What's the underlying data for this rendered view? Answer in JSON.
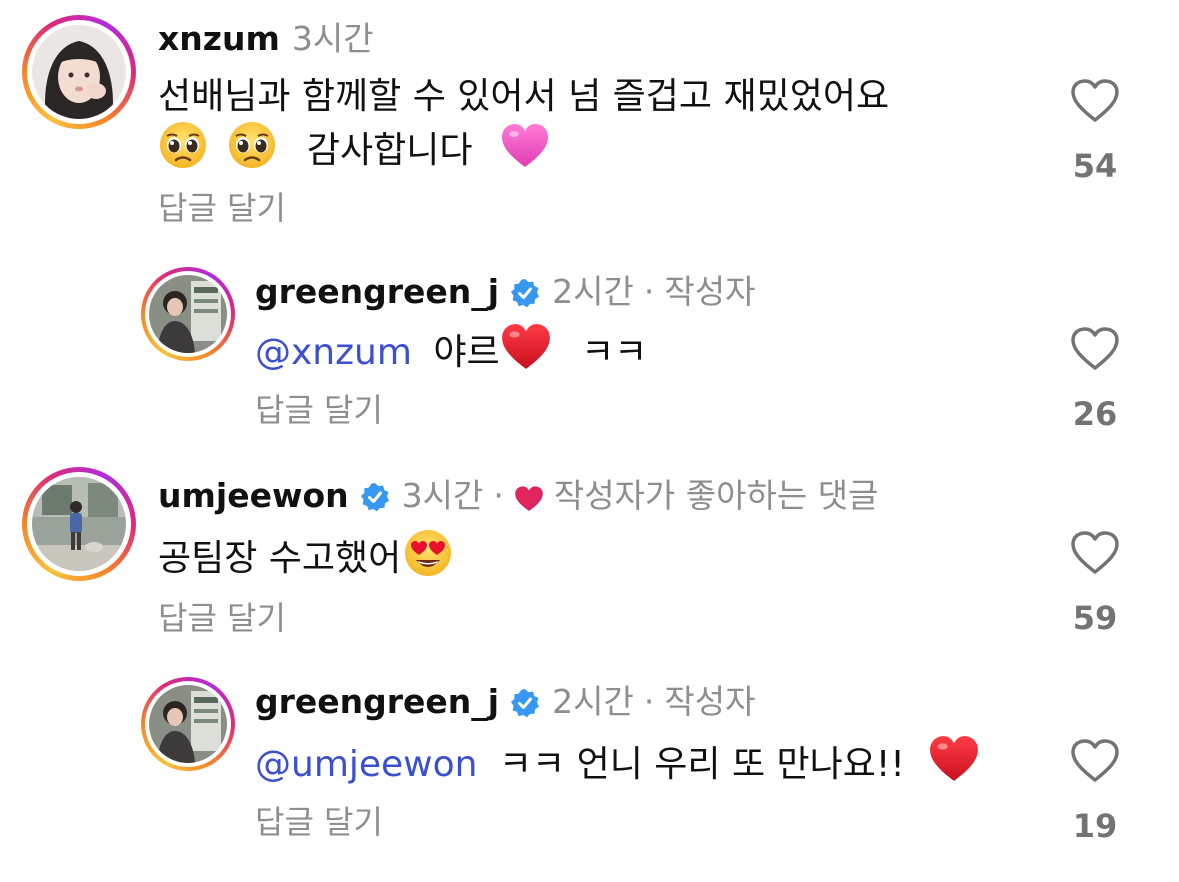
{
  "comments": [
    {
      "username": "xnzum",
      "time": "3시간",
      "text_line1": "선배님과 함께할 수 있어서 넘 즐겁고 재밌었어요",
      "text_line2": "감사합니다",
      "emojis": [
        "pleading-face-emoji",
        "pleading-face-emoji",
        "pink-heart-emoji"
      ],
      "reply_label": "답글 달기",
      "likes": "54"
    },
    {
      "username": "greengreen_j",
      "verified": true,
      "time": "2시간",
      "separator": "·",
      "author_tag": "작성자",
      "mention": "@xnzum",
      "text": "야르",
      "text_after": "ㅋㅋ",
      "emojis": [
        "red-heart-emoji"
      ],
      "reply_label": "답글 달기",
      "likes": "26"
    },
    {
      "username": "umjeewon",
      "verified": true,
      "time": "3시간",
      "separator": "·",
      "liked_by_author_label": "작성자가 좋아하는 댓글",
      "text": "공팀장 수고했어",
      "emojis": [
        "heart-eyes-emoji"
      ],
      "reply_label": "답글 달기",
      "likes": "59"
    },
    {
      "username": "greengreen_j",
      "verified": true,
      "time": "2시간",
      "separator": "·",
      "author_tag": "작성자",
      "mention": "@umjeewon",
      "text": "ㅋㅋ 언니 우리 또 만나요!!",
      "emojis": [
        "red-heart-emoji"
      ],
      "reply_label": "답글 달기",
      "likes": "19"
    }
  ],
  "colors": {
    "mention": "#3b4fd1",
    "meta_gray": "#8e8e8e",
    "count_gray": "#737373",
    "verified_blue": "#3897f0",
    "heart_red": "#e0245e"
  }
}
